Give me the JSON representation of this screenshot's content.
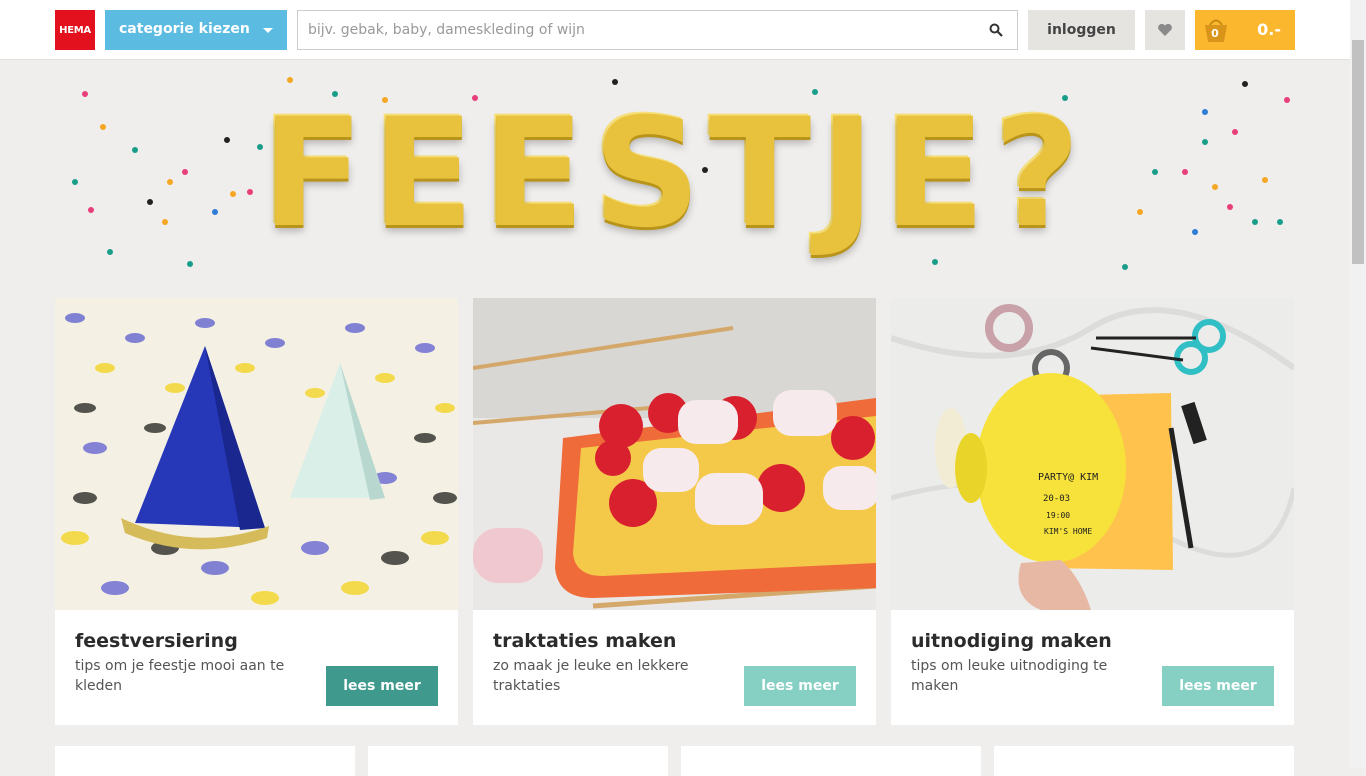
{
  "header": {
    "logo": "HEMA",
    "category_label": "categorie kiezen",
    "search_placeholder": "bijv. gebak, baby, dameskleding of wijn",
    "login_label": "inloggen",
    "cart_count": "0",
    "cart_total": "0.-"
  },
  "banner": {
    "text": "FEESTJE?"
  },
  "cards": [
    {
      "title": "feestversiering",
      "desc": "tips om je feestje mooi aan te kleden",
      "button": "lees meer"
    },
    {
      "title": "traktaties maken",
      "desc": "zo maak je leuke en lekkere traktaties",
      "button": "lees meer"
    },
    {
      "title": "uitnodiging maken",
      "desc": "tips om leuke uitnodiging te maken",
      "button": "lees meer"
    }
  ],
  "photo3_text": {
    "line1": "PARTY@ KIM",
    "line2": "20-03",
    "line3": "19:00",
    "line4": "KIM'S HOME"
  },
  "colors": {
    "brand_red": "#e3101e",
    "category_blue": "#5bbbe0",
    "cart_yellow": "#fbb72e",
    "button_dark": "#3f9a8d",
    "button_light": "#85cfc3"
  },
  "icons": [
    "search-icon",
    "heart-icon",
    "basket-icon",
    "caret-down-icon"
  ]
}
